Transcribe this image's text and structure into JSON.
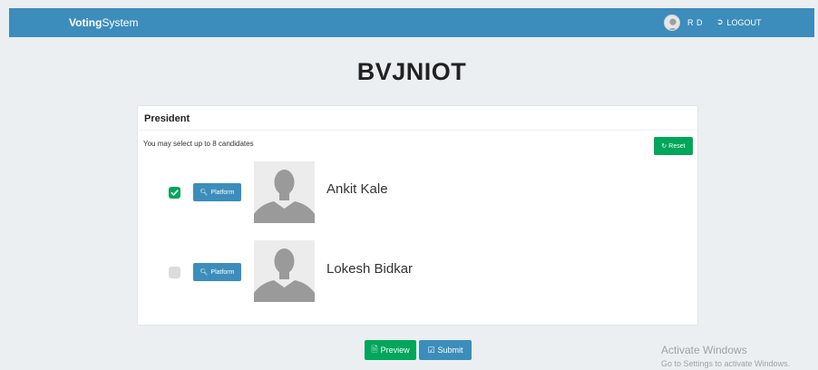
{
  "navbar": {
    "brand_bold": "Voting",
    "brand_rest": "System",
    "user_name": "R D",
    "logout_label": "LOGOUT"
  },
  "page_title": "BVJNIOT",
  "ballot": {
    "position": "President",
    "hint": "You may select up to 8 candidates",
    "reset_label": "Reset",
    "candidates": [
      {
        "name": "Ankit Kale",
        "selected": true,
        "platform_label": "Platform"
      },
      {
        "name": "Lokesh Bidkar",
        "selected": false,
        "platform_label": "Platform"
      }
    ]
  },
  "actions": {
    "preview_label": "Preview",
    "submit_label": "Submit"
  },
  "watermark": {
    "title": "Activate Windows",
    "subtitle": "Go to Settings to activate Windows."
  },
  "colors": {
    "navbar": "#3c8dbc",
    "success": "#00a65a",
    "primary": "#3c8dbc",
    "background": "#eceff1"
  }
}
